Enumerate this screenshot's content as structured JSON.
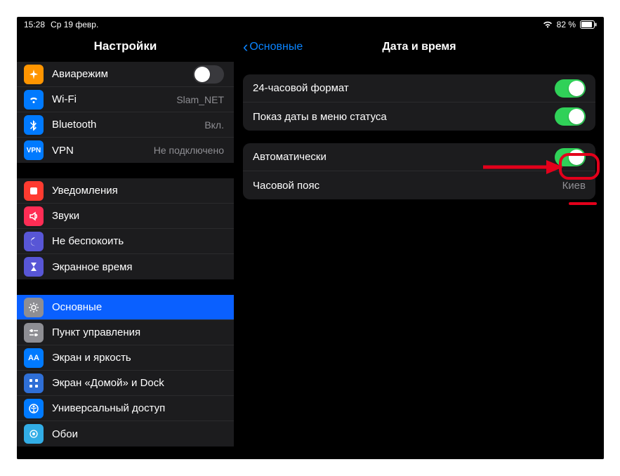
{
  "status": {
    "time": "15:28",
    "date": "Ср 19 февр.",
    "battery": "82 %"
  },
  "sidebar": {
    "title": "Настройки",
    "g1": {
      "airplane": "Авиарежим",
      "wifi": "Wi-Fi",
      "wifi_val": "Slam_NET",
      "bt": "Bluetooth",
      "bt_val": "Вкл.",
      "vpn": "VPN",
      "vpn_val": "Не подключено",
      "vpn_badge": "VPN"
    },
    "g2": {
      "notif": "Уведомления",
      "sound": "Звуки",
      "dnd": "Не беспокоить",
      "screentime": "Экранное время"
    },
    "g3": {
      "general": "Основные",
      "control": "Пункт управления",
      "display": "Экран и яркость",
      "home": "Экран «Домой» и Dock",
      "access": "Универсальный доступ",
      "wallpaper": "Обои"
    }
  },
  "detail": {
    "back": "Основные",
    "title": "Дата и время",
    "g1": {
      "h24": "24-часовой формат",
      "showdate": "Показ даты в меню статуса"
    },
    "g2": {
      "auto": "Автоматически",
      "tz": "Часовой пояс",
      "tz_val": "Киев"
    }
  }
}
